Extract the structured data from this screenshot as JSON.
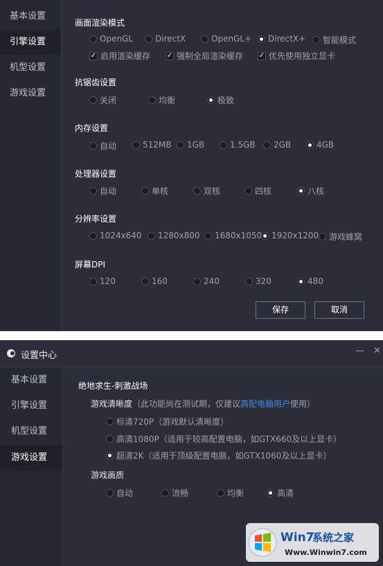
{
  "panel1": {
    "sidebar": [
      "基本设置",
      "引擎设置",
      "机型设置",
      "游戏设置"
    ],
    "render": {
      "title": "画面渲染模式",
      "options": [
        "OpenGL",
        "DirectX",
        "OpenGL+",
        "DirectX+",
        "智能模式"
      ],
      "selected": "DirectX+",
      "checks": [
        "启用渲染缓存",
        "强制全局渲染缓存",
        "优先使用独立显卡"
      ]
    },
    "aa": {
      "title": "抗锯齿设置",
      "options": [
        "关闭",
        "均衡",
        "极致"
      ],
      "selected": "极致"
    },
    "memory": {
      "title": "内存设置",
      "options": [
        "自动",
        "512MB",
        "1GB",
        "1.5GB",
        "2GB",
        "4GB"
      ],
      "selected": "4GB"
    },
    "cpu": {
      "title": "处理器设置",
      "options": [
        "自动",
        "单核",
        "双核",
        "四核",
        "八核"
      ],
      "selected": "八核"
    },
    "resolution": {
      "title": "分辨率设置",
      "options": [
        "1024x640",
        "1280x800",
        "1680x1050",
        "1920x1200",
        "游戏蜂窝"
      ],
      "selected": "1920x1200"
    },
    "dpi": {
      "title": "屏幕DPI",
      "options": [
        "120",
        "160",
        "240",
        "320",
        "480"
      ],
      "selected": "480"
    },
    "save_label": "保存",
    "cancel_label": "取消"
  },
  "panel2": {
    "title": "设置中心",
    "minimize_glyph": "—",
    "close_glyph": "✕",
    "sidebar": [
      "基本设置",
      "引擎设置",
      "机型设置",
      "游戏设置"
    ],
    "game_title": "绝地求生-刺激战场",
    "clarity": {
      "title": "游戏清晰度",
      "hint_pre": "（此功能尚在测试期，仅建议",
      "hint_link": "高配电脑用户",
      "hint_post": "使用）",
      "options": [
        "标清720P（游戏默认清晰度）",
        "高清1080P（适用于较高配置电脑，如GTX660及以上显卡）",
        "超清2K（适用于顶级配置电脑，如GTX1060及以上显卡）"
      ],
      "selected_index": 2
    },
    "quality": {
      "title": "游戏画质",
      "options": [
        "自动",
        "流畅",
        "均衡",
        "高清"
      ],
      "selected": "高清"
    }
  },
  "watermark": {
    "brand": "Win7",
    "brand_suffix": "系统之家",
    "url": "Www.Winwin7.com"
  }
}
